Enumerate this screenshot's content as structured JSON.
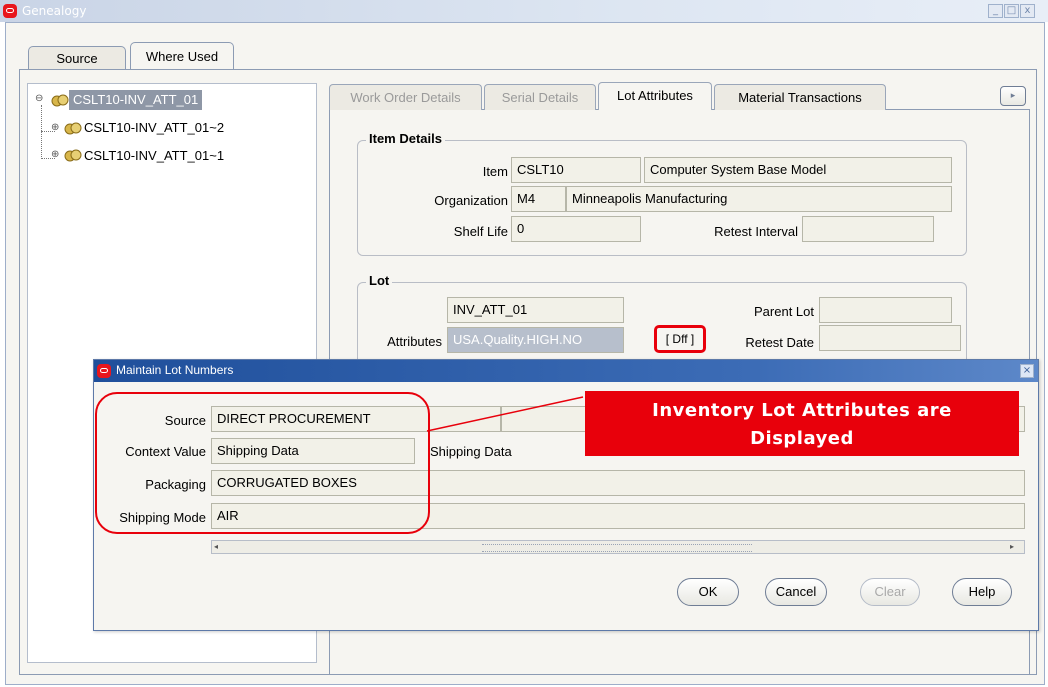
{
  "window": {
    "title": "Genealogy",
    "min": "_",
    "max": "□",
    "close": "x"
  },
  "main_tabs": [
    {
      "label": "Source"
    },
    {
      "label": "Where Used"
    }
  ],
  "tree": {
    "root": "CSLT10-INV_ATT_01",
    "children": [
      "CSLT10-INV_ATT_01~2",
      "CSLT10-INV_ATT_01~1"
    ]
  },
  "detail_tabs": [
    {
      "label": "Work Order Details"
    },
    {
      "label": "Serial Details"
    },
    {
      "label": "Lot Attributes"
    },
    {
      "label": "Material Transactions"
    }
  ],
  "scroll_right": "▸",
  "item_details": {
    "title": "Item Details",
    "item_label": "Item",
    "item": "CSLT10",
    "item_desc": "Computer System Base Model",
    "org_label": "Organization",
    "org": "M4",
    "org_desc": "Minneapolis Manufacturing",
    "shelf_label": "Shelf Life",
    "shelf": "0",
    "retest_interval_label": "Retest Interval",
    "retest_interval": ""
  },
  "lot": {
    "title": "Lot",
    "lot_label": "Lot",
    "lot": "INV_ATT_01",
    "parent_label": "Parent Lot",
    "parent": "",
    "attributes_label": "Attributes",
    "attributes": "USA.Quality.HIGH.NO",
    "dff": "[ Dff ]",
    "retest_date_label": "Retest Date",
    "retest_date": ""
  },
  "dialog": {
    "title": "Maintain Lot Numbers",
    "source_label": "Source",
    "source": "DIRECT PROCUREMENT",
    "context_label": "Context Value",
    "context": "Shipping Data",
    "context_desc": "Shipping Data",
    "packaging_label": "Packaging",
    "packaging": "CORRUGATED BOXES",
    "shipping_label": "Shipping Mode",
    "shipping": "AIR",
    "buttons": {
      "ok": "OK",
      "cancel": "Cancel",
      "clear": "Clear",
      "help": "Help"
    }
  },
  "callout": {
    "line1": "Inventory Lot Attributes are",
    "line2": "Displayed"
  },
  "colors": {
    "highlight": "#e8000b",
    "title_blue": "#1f4f9b",
    "field_bg": "#f2f1e8"
  }
}
